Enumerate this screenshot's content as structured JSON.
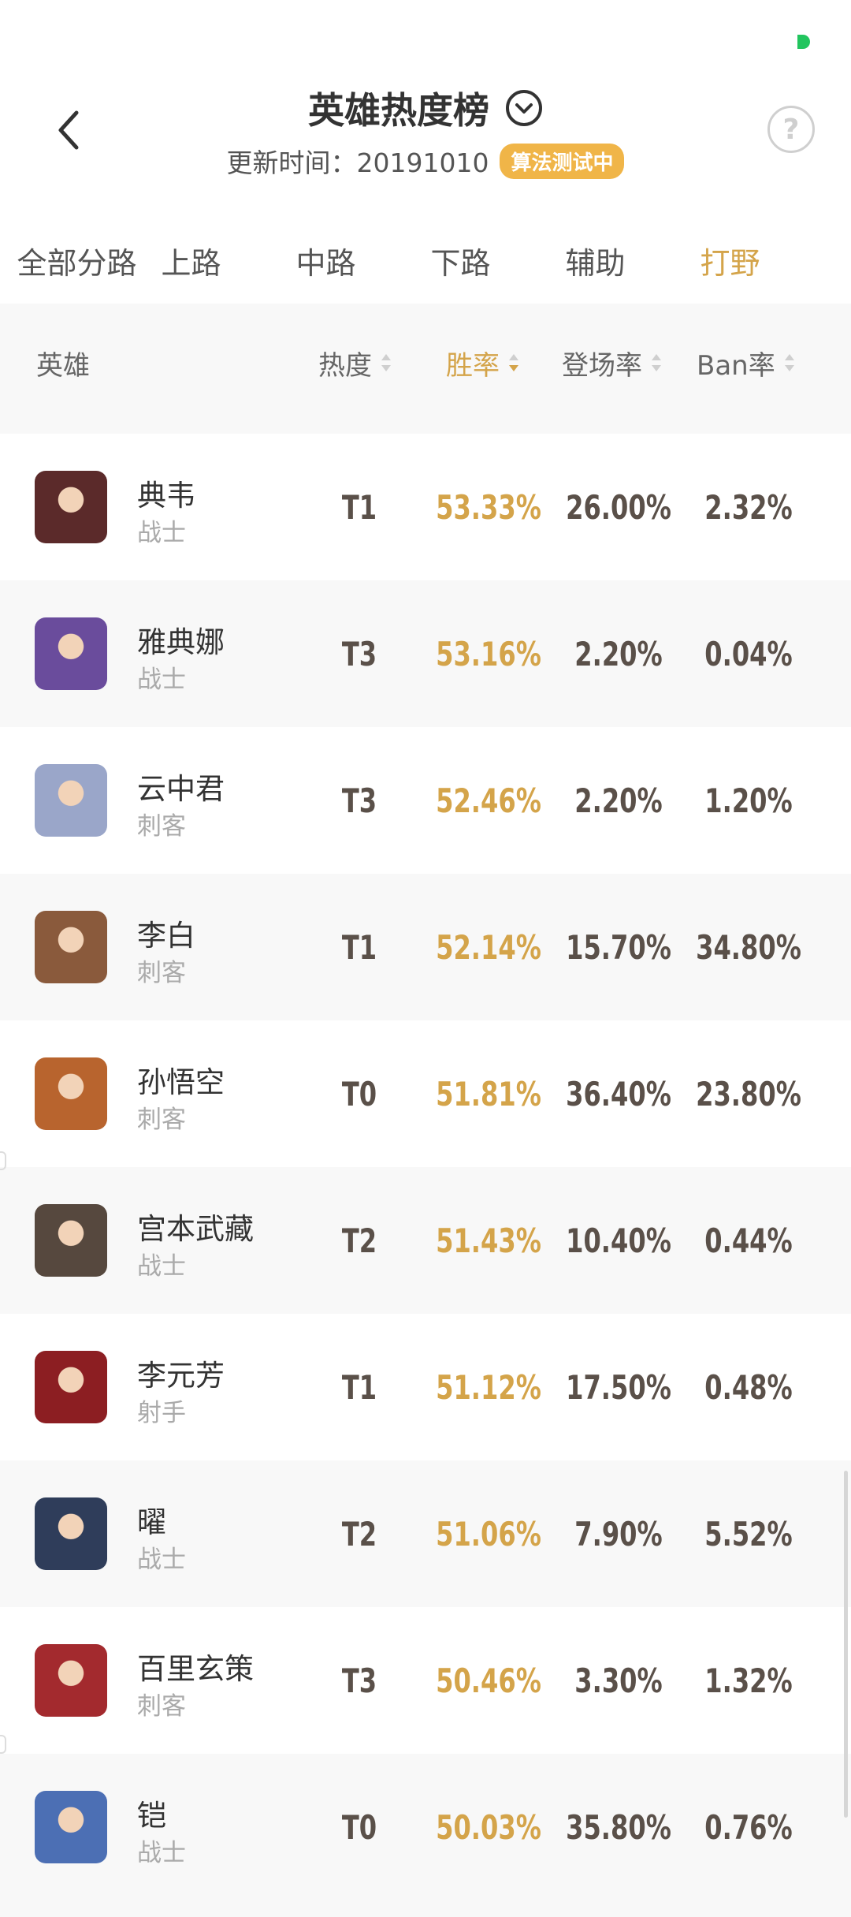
{
  "header": {
    "title": "英雄热度榜",
    "update_time": "更新时间：20191010",
    "badge": "算法测试中",
    "help": "?"
  },
  "tabs": [
    "全部分路",
    "上路",
    "中路",
    "下路",
    "辅助",
    "打野"
  ],
  "active_tab": "打野",
  "table_header": {
    "hero": "英雄",
    "heat": "热度",
    "win_rate": "胜率",
    "appear_rate": "登场率",
    "ban_rate": "Ban率"
  },
  "rows": [
    {
      "name": "典韦",
      "role": "战士",
      "tier": "T1",
      "win": "53.33%",
      "appear": "26.00%",
      "ban": "2.32%",
      "color": "#5b2a2a"
    },
    {
      "name": "雅典娜",
      "role": "战士",
      "tier": "T3",
      "win": "53.16%",
      "appear": "2.20%",
      "ban": "0.04%",
      "color": "#6a4c9c"
    },
    {
      "name": "云中君",
      "role": "刺客",
      "tier": "T3",
      "win": "52.46%",
      "appear": "2.20%",
      "ban": "1.20%",
      "color": "#9aa6c9"
    },
    {
      "name": "李白",
      "role": "刺客",
      "tier": "T1",
      "win": "52.14%",
      "appear": "15.70%",
      "ban": "34.80%",
      "color": "#8a5a3c"
    },
    {
      "name": "孙悟空",
      "role": "刺客",
      "tier": "T0",
      "win": "51.81%",
      "appear": "36.40%",
      "ban": "23.80%",
      "color": "#b8642e"
    },
    {
      "name": "宫本武藏",
      "role": "战士",
      "tier": "T2",
      "win": "51.43%",
      "appear": "10.40%",
      "ban": "0.44%",
      "color": "#56483e"
    },
    {
      "name": "李元芳",
      "role": "射手",
      "tier": "T1",
      "win": "51.12%",
      "appear": "17.50%",
      "ban": "0.48%",
      "color": "#8c1e22"
    },
    {
      "name": "曜",
      "role": "战士",
      "tier": "T2",
      "win": "51.06%",
      "appear": "7.90%",
      "ban": "5.52%",
      "color": "#2f3d5a"
    },
    {
      "name": "百里玄策",
      "role": "刺客",
      "tier": "T3",
      "win": "50.46%",
      "appear": "3.30%",
      "ban": "1.32%",
      "color": "#a32a2e"
    },
    {
      "name": "铠",
      "role": "战士",
      "tier": "T0",
      "win": "50.03%",
      "appear": "35.80%",
      "ban": "0.76%",
      "color": "#4c6fb4"
    }
  ],
  "colors": {
    "accent": "#d4a44a",
    "badge": "#f0b548",
    "status_green": "#22c55e"
  }
}
